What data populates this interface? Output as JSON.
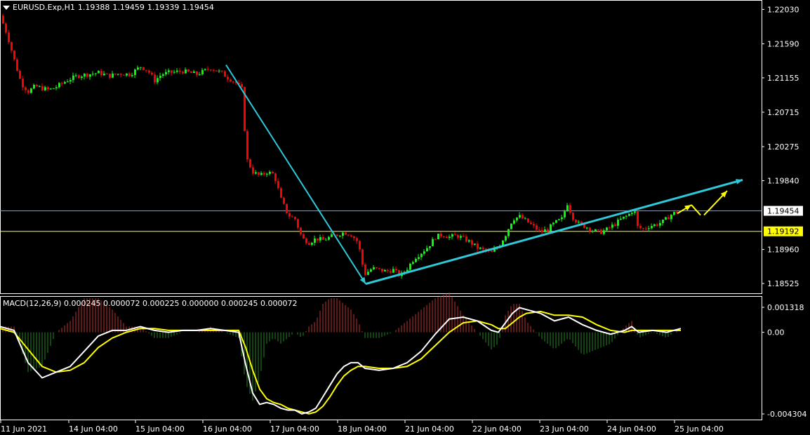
{
  "header": {
    "symbol": "EURUSD.Exp,H1",
    "open": "1.19388",
    "high": "1.19459",
    "low": "1.19339",
    "close": "1.19454"
  },
  "macd_header": "MACD(12,26,9) 0.000245 0.000072 0.000225 0.000000 0.000245 0.000072",
  "price_axis_labels": [
    "1.22030",
    "1.21590",
    "1.21155",
    "1.20715",
    "1.20275",
    "1.19840",
    "1.19454",
    "1.19192",
    "1.18960",
    "1.18525"
  ],
  "macd_axis_labels": [
    "0.001318",
    "0.00",
    "-0.004304"
  ],
  "time_labels": [
    "11 Jun 2021",
    "14 Jun 04:00",
    "15 Jun 04:00",
    "16 Jun 04:00",
    "17 Jun 04:00",
    "18 Jun 04:00",
    "21 Jun 04:00",
    "22 Jun 04:00",
    "23 Jun 04:00",
    "24 Jun 04:00",
    "25 Jun 04:00"
  ],
  "colors": {
    "background": "#000000",
    "bull": "#00ff00",
    "bear": "#ff0000",
    "macd_line": "#ffffff",
    "signal_line": "#ffff00",
    "trend_arrow": "#2ec8d8",
    "projection_arrow": "#ffff00",
    "level_line": "#ffff00",
    "current_price_line": "#8a9aa8"
  },
  "chart_data": [
    {
      "type": "candlestick",
      "symbol": "EURUSD.Exp",
      "timeframe": "H1",
      "ylim": [
        1.184,
        1.2215
      ],
      "levels": [
        {
          "value": 1.19454,
          "label": "1.19454",
          "kind": "current-price"
        },
        {
          "value": 1.19192,
          "label": "1.19192",
          "kind": "horizontal-line"
        }
      ],
      "close_path": [
        [
          0,
          1.2195
        ],
        [
          10,
          1.217
        ],
        [
          20,
          1.2138
        ],
        [
          30,
          1.2108
        ],
        [
          40,
          1.2098
        ],
        [
          50,
          1.2105
        ],
        [
          60,
          1.2102
        ],
        [
          70,
          1.21
        ],
        [
          80,
          1.2104
        ],
        [
          95,
          1.2112
        ],
        [
          110,
          1.2118
        ],
        [
          125,
          1.212
        ],
        [
          140,
          1.2122
        ],
        [
          155,
          1.2118
        ],
        [
          170,
          1.2121
        ],
        [
          185,
          1.212
        ],
        [
          200,
          1.213
        ],
        [
          210,
          1.2125
        ],
        [
          220,
          1.2112
        ],
        [
          230,
          1.212
        ],
        [
          240,
          1.2122
        ],
        [
          260,
          1.2124
        ],
        [
          280,
          1.212
        ],
        [
          300,
          1.2128
        ],
        [
          315,
          1.2122
        ],
        [
          325,
          1.2115
        ],
        [
          335,
          1.211
        ],
        [
          345,
          1.21
        ],
        [
          348,
          1.205
        ],
        [
          352,
          1.201
        ],
        [
          360,
          1.1995
        ],
        [
          370,
          1.199
        ],
        [
          380,
          1.1995
        ],
        [
          390,
          1.1992
        ],
        [
          400,
          1.196
        ],
        [
          410,
          1.194
        ],
        [
          420,
          1.1935
        ],
        [
          430,
          1.191
        ],
        [
          440,
          1.1905
        ],
        [
          450,
          1.191
        ],
        [
          460,
          1.1908
        ],
        [
          470,
          1.1912
        ],
        [
          480,
          1.1915
        ],
        [
          490,
          1.1918
        ],
        [
          500,
          1.1915
        ],
        [
          510,
          1.1905
        ],
        [
          515,
          1.188
        ],
        [
          520,
          1.1865
        ],
        [
          530,
          1.1872
        ],
        [
          540,
          1.187
        ],
        [
          550,
          1.1868
        ],
        [
          560,
          1.187
        ],
        [
          570,
          1.1862
        ],
        [
          580,
          1.1872
        ],
        [
          590,
          1.1885
        ],
        [
          600,
          1.1892
        ],
        [
          610,
          1.19
        ],
        [
          620,
          1.1912
        ],
        [
          630,
          1.1915
        ],
        [
          640,
          1.1912
        ],
        [
          650,
          1.1914
        ],
        [
          660,
          1.191
        ],
        [
          670,
          1.1905
        ],
        [
          680,
          1.1898
        ],
        [
          690,
          1.1895
        ],
        [
          700,
          1.1892
        ],
        [
          710,
          1.19
        ],
        [
          720,
          1.1915
        ],
        [
          730,
          1.1935
        ],
        [
          740,
          1.1938
        ],
        [
          750,
          1.1932
        ],
        [
          760,
          1.1925
        ],
        [
          770,
          1.1918
        ],
        [
          780,
          1.1922
        ],
        [
          790,
          1.193
        ],
        [
          800,
          1.1935
        ],
        [
          808,
          1.1955
        ],
        [
          815,
          1.1938
        ],
        [
          825,
          1.1928
        ],
        [
          835,
          1.1925
        ],
        [
          845,
          1.192
        ],
        [
          855,
          1.1918
        ],
        [
          865,
          1.1922
        ],
        [
          875,
          1.1928
        ],
        [
          885,
          1.1935
        ],
        [
          895,
          1.194
        ],
        [
          903,
          1.1948
        ],
        [
          908,
          1.1925
        ],
        [
          915,
          1.1922
        ],
        [
          925,
          1.1926
        ],
        [
          935,
          1.1928
        ],
        [
          945,
          1.1932
        ],
        [
          955,
          1.194
        ],
        [
          965,
          1.1945
        ]
      ]
    },
    {
      "type": "line",
      "title": "MACD(12,26,9)",
      "ylim": [
        -0.004304,
        0.001318
      ],
      "series": [
        {
          "name": "MACD",
          "points": [
            [
              0,
              0.0003
            ],
            [
              20,
              0.0001
            ],
            [
              40,
              -0.0016
            ],
            [
              60,
              -0.0024
            ],
            [
              80,
              -0.0021
            ],
            [
              100,
              -0.0018
            ],
            [
              120,
              -0.001
            ],
            [
              140,
              -0.0002
            ],
            [
              160,
              0.0001
            ],
            [
              180,
              0.0001
            ],
            [
              200,
              0.0003
            ],
            [
              220,
              0.0001
            ],
            [
              240,
              0.0
            ],
            [
              260,
              0.0001
            ],
            [
              280,
              0.0001
            ],
            [
              300,
              0.0002
            ],
            [
              320,
              0.0001
            ],
            [
              340,
              0.0
            ],
            [
              350,
              -0.0017
            ],
            [
              360,
              -0.0032
            ],
            [
              370,
              -0.0038
            ],
            [
              380,
              -0.0037
            ],
            [
              390,
              -0.0038
            ],
            [
              400,
              -0.004
            ],
            [
              410,
              -0.0041
            ],
            [
              420,
              -0.0041
            ],
            [
              430,
              -0.0043
            ],
            [
              440,
              -0.0042
            ],
            [
              450,
              -0.004
            ],
            [
              460,
              -0.0034
            ],
            [
              470,
              -0.0028
            ],
            [
              480,
              -0.0022
            ],
            [
              490,
              -0.0018
            ],
            [
              500,
              -0.0016
            ],
            [
              510,
              -0.0016
            ],
            [
              520,
              -0.0019
            ],
            [
              540,
              -0.002
            ],
            [
              560,
              -0.0019
            ],
            [
              580,
              -0.0016
            ],
            [
              600,
              -0.001
            ],
            [
              620,
              -0.0001
            ],
            [
              640,
              0.0007
            ],
            [
              660,
              0.0008
            ],
            [
              680,
              0.0006
            ],
            [
              700,
              0.0001
            ],
            [
              710,
              0.0
            ],
            [
              720,
              0.0005
            ],
            [
              730,
              0.001
            ],
            [
              740,
              0.0013
            ],
            [
              750,
              0.0012
            ],
            [
              770,
              0.001
            ],
            [
              790,
              0.0006
            ],
            [
              810,
              0.0008
            ],
            [
              830,
              0.0004
            ],
            [
              850,
              0.0001
            ],
            [
              870,
              -0.0001
            ],
            [
              890,
              0.0001
            ],
            [
              900,
              0.0003
            ],
            [
              910,
              0.0
            ],
            [
              930,
              0.0001
            ],
            [
              950,
              0.0
            ],
            [
              970,
              0.0002
            ]
          ]
        },
        {
          "name": "Signal",
          "points": [
            [
              0,
              0.0002
            ],
            [
              20,
              0.0
            ],
            [
              40,
              -0.0009
            ],
            [
              60,
              -0.0018
            ],
            [
              80,
              -0.0021
            ],
            [
              100,
              -0.002
            ],
            [
              120,
              -0.0016
            ],
            [
              140,
              -0.0008
            ],
            [
              160,
              -0.0003
            ],
            [
              180,
              0.0
            ],
            [
              200,
              0.0002
            ],
            [
              220,
              0.0002
            ],
            [
              240,
              0.0001
            ],
            [
              260,
              0.0001
            ],
            [
              280,
              0.0001
            ],
            [
              300,
              0.0001
            ],
            [
              320,
              0.0001
            ],
            [
              340,
              0.0001
            ],
            [
              350,
              -0.0008
            ],
            [
              360,
              -0.002
            ],
            [
              370,
              -0.003
            ],
            [
              380,
              -0.0035
            ],
            [
              390,
              -0.0037
            ],
            [
              400,
              -0.0038
            ],
            [
              410,
              -0.004
            ],
            [
              420,
              -0.0041
            ],
            [
              430,
              -0.0042
            ],
            [
              440,
              -0.0043
            ],
            [
              450,
              -0.0042
            ],
            [
              460,
              -0.0039
            ],
            [
              470,
              -0.0034
            ],
            [
              480,
              -0.0028
            ],
            [
              490,
              -0.0023
            ],
            [
              500,
              -0.002
            ],
            [
              510,
              -0.0018
            ],
            [
              520,
              -0.0018
            ],
            [
              540,
              -0.0019
            ],
            [
              560,
              -0.0019
            ],
            [
              580,
              -0.0018
            ],
            [
              600,
              -0.0014
            ],
            [
              620,
              -0.0007
            ],
            [
              640,
              0.0
            ],
            [
              660,
              0.0005
            ],
            [
              680,
              0.0006
            ],
            [
              700,
              0.0004
            ],
            [
              710,
              0.0002
            ],
            [
              720,
              0.0002
            ],
            [
              730,
              0.0005
            ],
            [
              740,
              0.0008
            ],
            [
              750,
              0.001
            ],
            [
              770,
              0.0011
            ],
            [
              790,
              0.0009
            ],
            [
              810,
              0.0009
            ],
            [
              830,
              0.0008
            ],
            [
              850,
              0.0004
            ],
            [
              870,
              0.0001
            ],
            [
              890,
              0.0
            ],
            [
              900,
              0.0001
            ],
            [
              910,
              0.0001
            ],
            [
              930,
              0.0001
            ],
            [
              950,
              0.0001
            ],
            [
              970,
              0.0001
            ]
          ]
        }
      ]
    }
  ]
}
